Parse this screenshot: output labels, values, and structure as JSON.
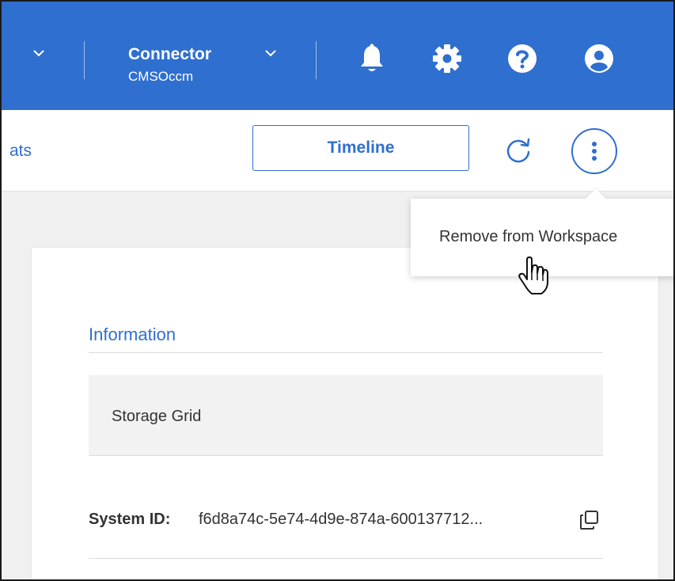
{
  "header": {
    "connector_label": "Connector",
    "connector_name": "CMSOccm",
    "icons": [
      "chevron-down-icon",
      "bell-icon",
      "gear-icon",
      "help-icon",
      "user-icon"
    ]
  },
  "toolbar": {
    "tab_partial": "ats",
    "timeline_label": "Timeline",
    "refresh_icon": "refresh-icon",
    "more_icon": "more-vertical-icon"
  },
  "menu": {
    "items": [
      {
        "label": "Remove from Workspace"
      }
    ]
  },
  "info": {
    "title": "Information",
    "type_value": "Storage Grid",
    "system_id_label": "System ID:",
    "system_id_value": "f6d8a74c-5e74-4d9e-874a-600137712...",
    "copy_icon": "copy-icon"
  },
  "colors": {
    "brand_blue": "#2f6fcf",
    "background": "#f0f0f0",
    "text": "#333333"
  }
}
